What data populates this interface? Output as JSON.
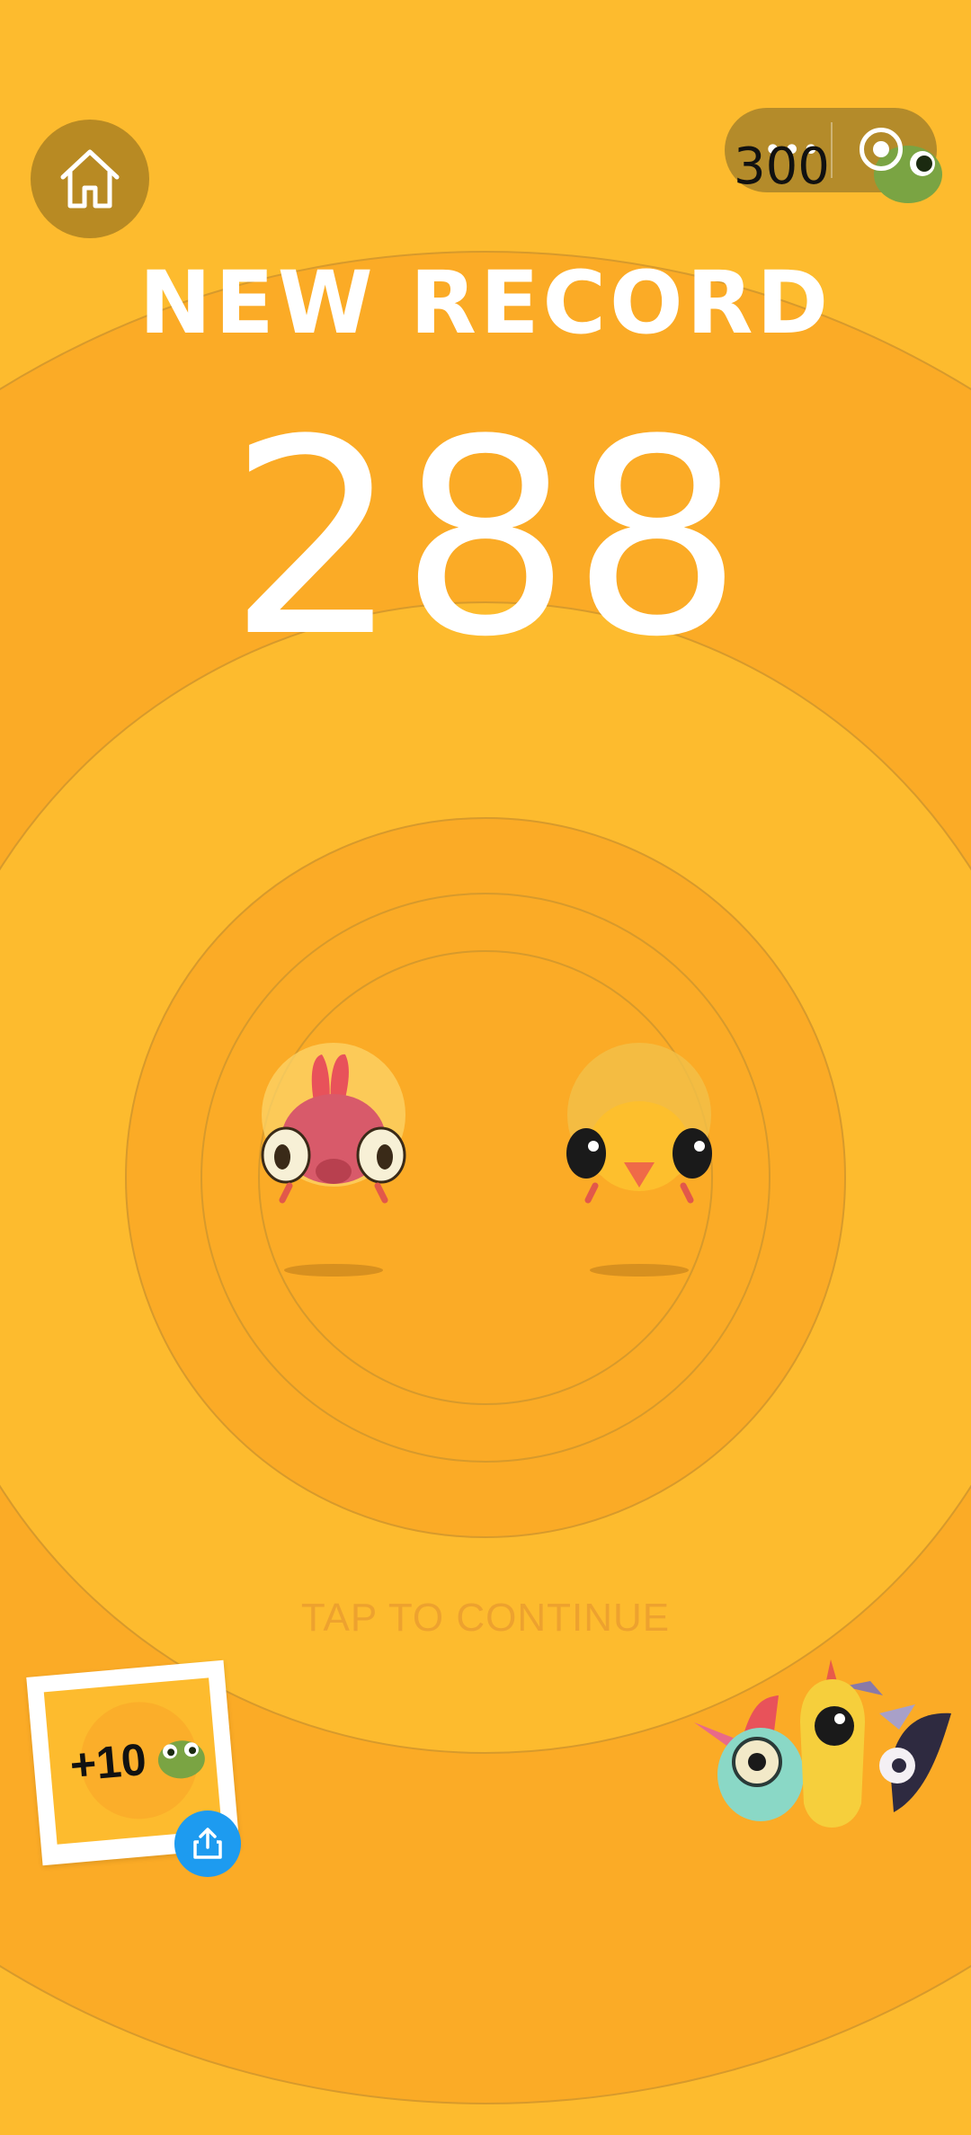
{
  "header": {
    "home_icon": "home-icon",
    "menu_label": "•••",
    "coins": "300",
    "capsule_icon": "capsule-close-icon",
    "currency_icon": "frog-coin-icon"
  },
  "result": {
    "title": "NEW RECORD",
    "score": "288"
  },
  "players": [
    {
      "character": "red-crested-bird",
      "color": "#e8525a"
    },
    {
      "character": "yellow-chick",
      "color": "#fdbf2d"
    }
  ],
  "hint": "TAP TO CONTINUE",
  "share_card": {
    "reward": "+10",
    "reward_icon": "frog-coin-icon",
    "share_icon": "share-icon"
  },
  "colors": {
    "background": "#fdbb2e",
    "ring_dark": "#fbab26",
    "share_blue": "#1d9bf0"
  }
}
